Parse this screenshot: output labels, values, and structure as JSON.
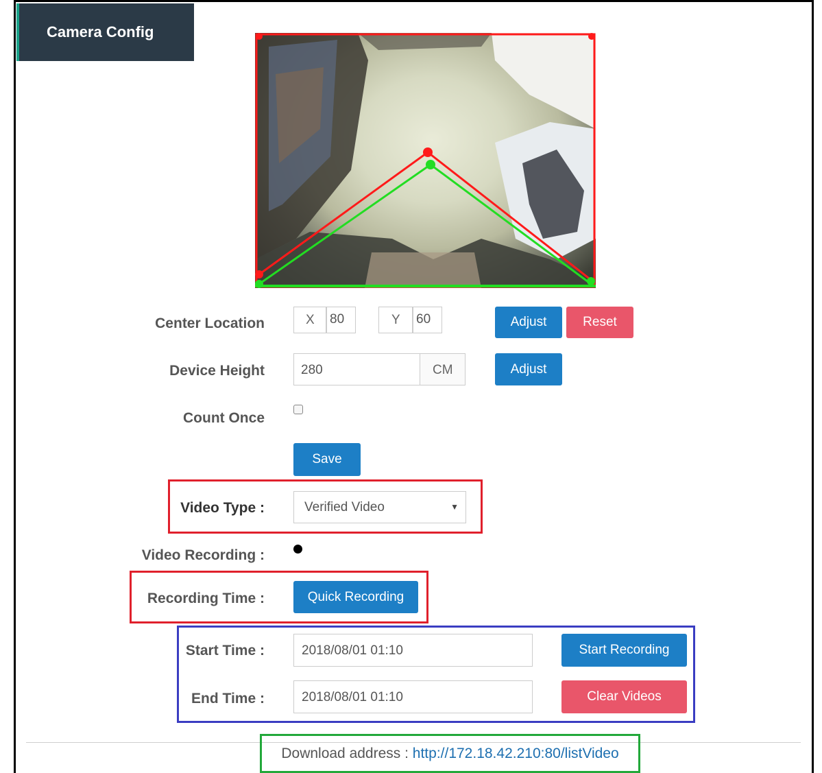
{
  "header": {
    "title": "Camera Config"
  },
  "center_location": {
    "label": "Center Location",
    "x_label": "X",
    "x_value": "80",
    "y_label": "Y",
    "y_value": "60",
    "adjust_label": "Adjust",
    "reset_label": "Reset"
  },
  "device_height": {
    "label": "Device Height",
    "value": "280",
    "unit": "CM",
    "adjust_label": "Adjust"
  },
  "count_once": {
    "label": "Count Once",
    "checked": false
  },
  "save_label": "Save",
  "video_type": {
    "label": "Video Type :",
    "selected": "Verified Video"
  },
  "video_recording": {
    "label": "Video Recording :"
  },
  "recording_time": {
    "label": "Recording Time :",
    "button_label": "Quick Recording"
  },
  "start_time": {
    "label": "Start Time :",
    "value": "2018/08/01 01:10",
    "button_label": "Start Recording"
  },
  "end_time": {
    "label": "End Time :",
    "value": "2018/08/01 01:10",
    "button_label": "Clear Videos"
  },
  "download": {
    "label": "Download address : ",
    "link": "http://172.18.42.210:80/listVideo"
  },
  "colors": {
    "accent_blue": "#1d7fc6",
    "accent_red": "#e9566a",
    "header_bg": "#2b3a47"
  }
}
